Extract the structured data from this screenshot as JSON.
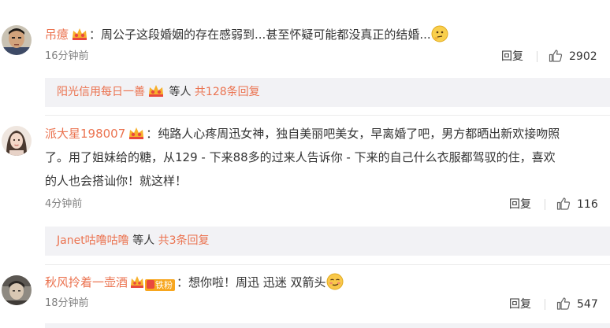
{
  "comments": [
    {
      "username": "吊癔",
      "text": "：周公子这段婚姻的存在感弱到...甚至怀疑可能都没真正的结婚...",
      "time": "16分钟前",
      "reply_label": "回复",
      "likes": "2902",
      "thread": {
        "user": "阳光信用每日一善",
        "others": "等人",
        "count_text": "共128条回复"
      }
    },
    {
      "username": "派大星198007",
      "text_line1": "：纯路人心疼周迅女神，独自美丽吧美女，早离婚了吧，男方都晒出新欢接吻照",
      "text_line2": "了。用了姐妹给的糖，从129 - 下来88多的过来人告诉你  - 下来的自己什么衣服都驾驭的住，喜欢",
      "text_line3": "的人也会搭讪你！就这样！",
      "time": "4分钟前",
      "reply_label": "回复",
      "likes": "116",
      "thread": {
        "user": "Janet咕噜咕噜",
        "others": "等人",
        "count_text": "共3条回复"
      }
    },
    {
      "username": "秋风拎着一壶酒",
      "fan_badge": "铁粉",
      "text": "：想你啦！周迅 迅迷  双箭头",
      "time": "18分钟前",
      "reply_label": "回复",
      "likes": "547"
    }
  ],
  "icons": {
    "vip_crown": "vip-crown-icon",
    "like": "thumbs-up-icon",
    "emoji_thinking": "thinking-face-emoji",
    "emoji_smirk": "smirk-face-emoji"
  },
  "colors": {
    "username": "#eb7350",
    "text": "#333333",
    "time": "#808080",
    "reply_bg": "#f2f2f5",
    "fan_badge": "#f7a61e"
  }
}
